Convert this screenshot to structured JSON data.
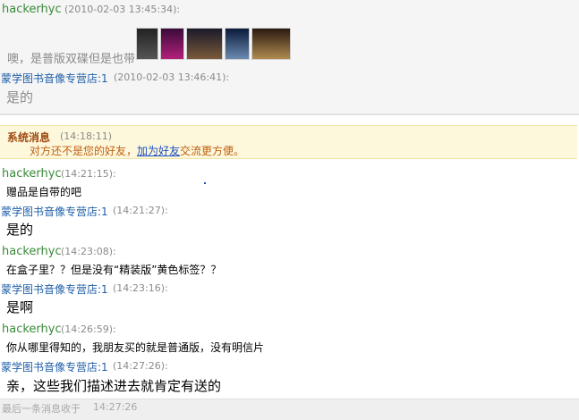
{
  "upper": {
    "sender1": "hackerhyc",
    "time1": "(2010-02-03 13:45:34):",
    "thumb_captions": [
      "",
      "",
      "",
      "",
      ""
    ],
    "message1": "噢，是普版双碟但是也带",
    "sender2": "蒙学图书音像专营店:1",
    "time2": "(2010-02-03 13:46:41):",
    "message2": "是的"
  },
  "system": {
    "title": "系统消息",
    "time": "(14:18:11)",
    "text_before": "对方还不是您的好友，",
    "link": "加为好友",
    "text_after": "交流更方便。"
  },
  "messages": [
    {
      "sender": "hackerhyc",
      "time": "(14:21:15):",
      "text": "赠品是自带的吧"
    },
    {
      "sender": "蒙学图书音像专营店:1",
      "time": "(14:21:27):",
      "text": "是的"
    },
    {
      "sender": "hackerhyc",
      "time": "(14:23:08):",
      "text": "在盒子里？？但是没有“精装版”黄色标签？？"
    },
    {
      "sender": "蒙学图书音像专营店:1",
      "time": "(14:23:16):",
      "text": "是啊"
    },
    {
      "sender": "hackerhyc",
      "time": "(14:26:59):",
      "text": "你从哪里得知的，我朋友买的就是普通版，没有明信片"
    },
    {
      "sender": "蒙学图书音像专营店:1",
      "time": "(14:27:26):",
      "text": "亲，这些我们描述进去就肯定有送的"
    }
  ],
  "footer": {
    "label": "最后一条消息收于",
    "time": "14:27:26"
  },
  "colors": {
    "customer": "#3a8a3a",
    "shop": "#1f5fa8",
    "system_bg": "#fdf7dc"
  }
}
